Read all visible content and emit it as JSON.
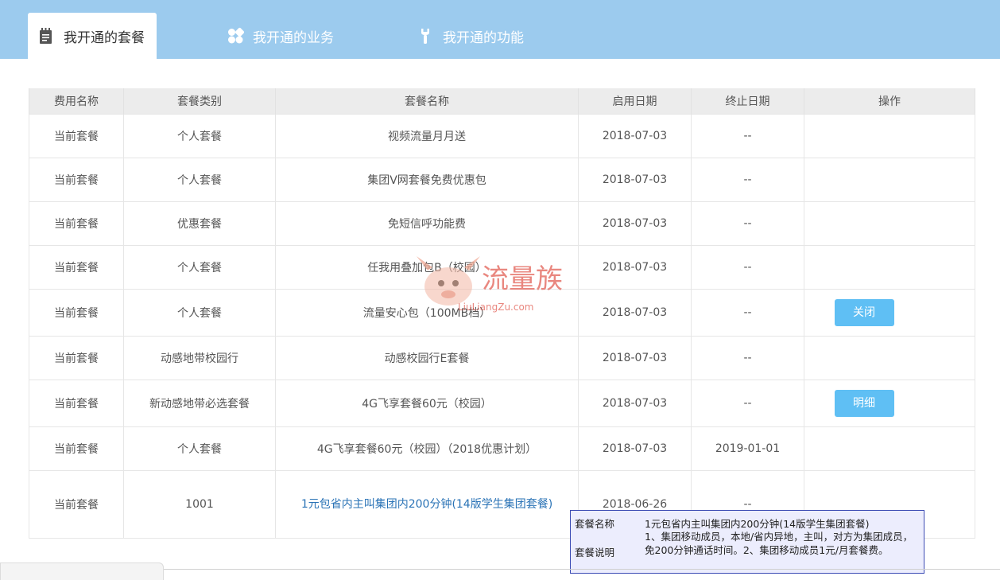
{
  "tabs": [
    {
      "label": "我开通的套餐",
      "icon": "notepad-icon"
    },
    {
      "label": "我开通的业务",
      "icon": "grid-icon"
    },
    {
      "label": "我开通的功能",
      "icon": "wrench-icon"
    }
  ],
  "table": {
    "headers": [
      "费用名称",
      "套餐类别",
      "套餐名称",
      "启用日期",
      "终止日期",
      "操作"
    ],
    "rows": [
      {
        "fee": "当前套餐",
        "category": "个人套餐",
        "name": "视频流量月月送",
        "start": "2018-07-03",
        "end": "--",
        "action": ""
      },
      {
        "fee": "当前套餐",
        "category": "个人套餐",
        "name": "集团V网套餐免费优惠包",
        "start": "2018-07-03",
        "end": "--",
        "action": ""
      },
      {
        "fee": "当前套餐",
        "category": "优惠套餐",
        "name": "免短信呼功能费",
        "start": "2018-07-03",
        "end": "--",
        "action": ""
      },
      {
        "fee": "当前套餐",
        "category": "个人套餐",
        "name": "任我用叠加包B（校园）",
        "start": "2018-07-03",
        "end": "--",
        "action": ""
      },
      {
        "fee": "当前套餐",
        "category": "个人套餐",
        "name": "流量安心包（100MB档）",
        "start": "2018-07-03",
        "end": "--",
        "action": "关闭"
      },
      {
        "fee": "当前套餐",
        "category": "动感地带校园行",
        "name": "动感校园行E套餐",
        "start": "2018-07-03",
        "end": "--",
        "action": ""
      },
      {
        "fee": "当前套餐",
        "category": "新动感地带必选套餐",
        "name": "4G飞享套餐60元（校园）",
        "start": "2018-07-03",
        "end": "--",
        "action": "明细"
      },
      {
        "fee": "当前套餐",
        "category": "个人套餐",
        "name": "4G飞享套餐60元（校园）（2018优惠计划）",
        "start": "2018-07-03",
        "end": "2019-01-01",
        "action": ""
      },
      {
        "fee": "当前套餐",
        "category": "1001",
        "name": "1元包省内主叫集团内200分钟(14版学生集团套餐)",
        "start": "2018-06-26",
        "end": "--",
        "action": ""
      }
    ]
  },
  "watermark": {
    "brand": "流量族",
    "url": "LiuLiangZu.com"
  },
  "tooltip": {
    "name_label": "套餐名称",
    "name_value": "1元包省内主叫集团内200分钟(14版学生集团套餐)",
    "desc_label": "套餐说明",
    "desc_value": "1、集团移动成员，本地/省内异地，主叫，对方为集团成员，免200分钟通话时间。2、集团移动成员1元/月套餐费。"
  },
  "colors": {
    "header_bar": "#9ccbee",
    "button": "#5fbff4",
    "link": "#2a73b6",
    "tooltip_bg": "#ecedfd",
    "tooltip_border": "#3b4bb4"
  }
}
